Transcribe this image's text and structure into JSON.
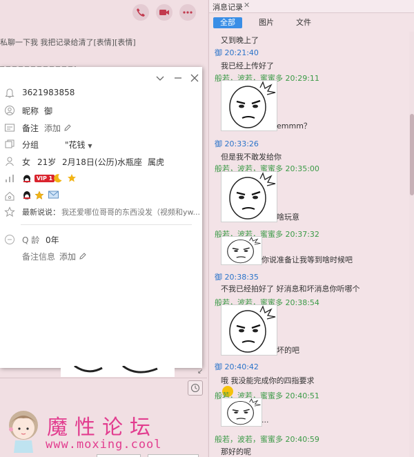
{
  "chat": {
    "toolbar": {
      "call_icon": "phone-icon",
      "video_icon": "video-camera-icon",
      "more_icon": "more-dots-icon"
    },
    "visible_message": "私聊一下我 我把记录给清了[表情][表情]"
  },
  "profile_card": {
    "qq_number": "3621983858",
    "nickname_label": "昵称",
    "nickname": "御",
    "remark_label": "备注",
    "remark_action": "添加",
    "group_label": "分组",
    "group_value": "\"花钱",
    "gender": "女",
    "age": "21岁",
    "birthday": "2月18日(公历)",
    "constellation": "水瓶座",
    "zodiac": "属虎",
    "vip_label": "VIP 1",
    "latest_say_label": "最新说说：",
    "latest_say": "我还爱哪位哥哥的东西没发（视频和yw...",
    "qage_label": "Q 龄",
    "qage_value": "0年",
    "remark_info_label": "备注信息",
    "remark_info_action": "添加"
  },
  "watermark": {
    "title": "魔性论坛",
    "url": "www.moxing.cool"
  },
  "history": {
    "tab_label": "消息记录",
    "tab_close": "✕",
    "filters": [
      "全部",
      "图片",
      "文件"
    ],
    "entries": [
      {
        "kind": "text",
        "text": "又到晚上了"
      },
      {
        "kind": "head",
        "who": "me",
        "text": "御 20:21:40"
      },
      {
        "kind": "text",
        "text": "我已经上传好了"
      },
      {
        "kind": "head",
        "who": "other",
        "text": "般若，波若，蜜蜜多 20:29:11"
      },
      {
        "kind": "meme",
        "caption": "emmm？"
      },
      {
        "kind": "head",
        "who": "me",
        "text": "御 20:33:26"
      },
      {
        "kind": "text",
        "text": "但是我不敢发给你"
      },
      {
        "kind": "head",
        "who": "other",
        "text": "般若，波若，蜜蜜多 20:35:00"
      },
      {
        "kind": "meme",
        "caption": "啥玩意"
      },
      {
        "kind": "head",
        "who": "other",
        "text": "般若，波若，蜜蜜多 20:37:32"
      },
      {
        "kind": "meme",
        "caption": "你说准备让我等到啥时候吧"
      },
      {
        "kind": "head",
        "who": "me",
        "text": "御 20:38:35"
      },
      {
        "kind": "text",
        "text": "不我已经拍好了 好消息和坏消息你听哪个"
      },
      {
        "kind": "head",
        "who": "other",
        "text": "般若，波若，蜜蜜多 20:38:54"
      },
      {
        "kind": "meme",
        "caption": "坏的吧"
      },
      {
        "kind": "head",
        "who": "me",
        "text": "御 20:40:42"
      },
      {
        "kind": "text",
        "text": "哦 我没能完成你的四指要求"
      },
      {
        "kind": "head",
        "who": "other",
        "text": "般若，波若，蜜蜜多 20:40:51"
      },
      {
        "kind": "meme",
        "caption": "..."
      },
      {
        "kind": "head",
        "who": "other",
        "text": "般若，波若，蜜蜜多 20:40:59"
      },
      {
        "kind": "text",
        "text": "那好的呢"
      }
    ]
  },
  "colors": {
    "accent": "#3a8ee6",
    "self_name": "#2a73c9",
    "other_name": "#3a9a46",
    "watermark": "#e23d8f",
    "vip": "#d9232d"
  }
}
